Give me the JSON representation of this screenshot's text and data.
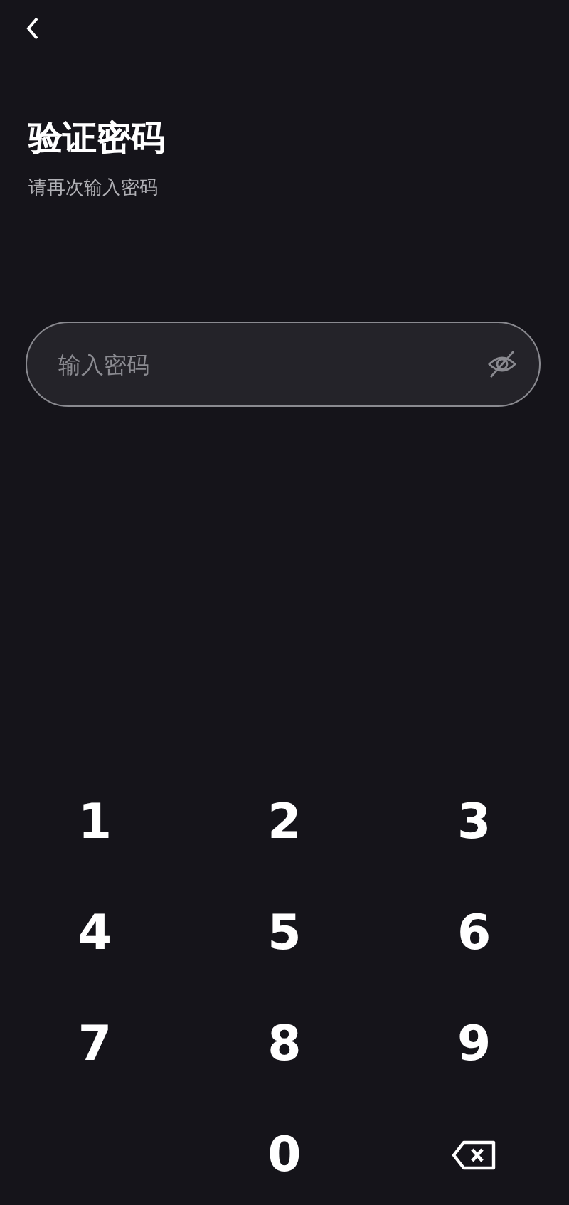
{
  "title": "验证密码",
  "subtitle": "请再次输入密码",
  "password_field": {
    "placeholder": "输入密码",
    "visible": false
  },
  "keypad": [
    {
      "kind": "digit",
      "label": "1"
    },
    {
      "kind": "digit",
      "label": "2"
    },
    {
      "kind": "digit",
      "label": "3"
    },
    {
      "kind": "digit",
      "label": "4"
    },
    {
      "kind": "digit",
      "label": "5"
    },
    {
      "kind": "digit",
      "label": "6"
    },
    {
      "kind": "digit",
      "label": "7"
    },
    {
      "kind": "digit",
      "label": "8"
    },
    {
      "kind": "digit",
      "label": "9"
    },
    {
      "kind": "empty"
    },
    {
      "kind": "digit",
      "label": "0"
    },
    {
      "kind": "backspace"
    }
  ]
}
